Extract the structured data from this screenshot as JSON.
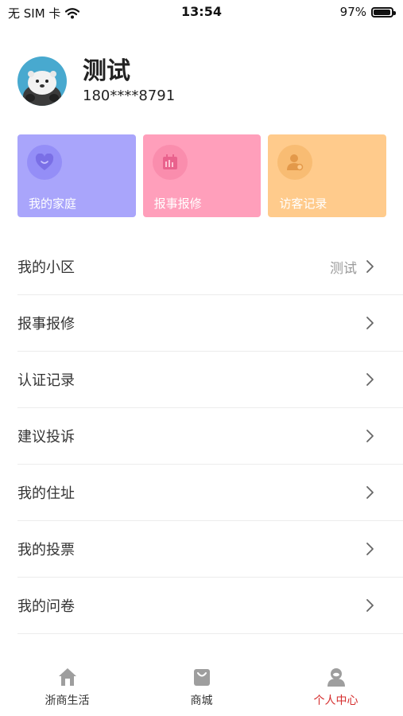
{
  "status_bar": {
    "carrier": "无 SIM 卡",
    "time": "13:54",
    "battery": "97%"
  },
  "profile": {
    "name": "测试",
    "phone": "180****8791"
  },
  "cards": [
    {
      "label": "我的家庭",
      "color": "#a9a5fb",
      "icon": "heart-icon"
    },
    {
      "label": "报事报修",
      "color": "#ff9fbb",
      "icon": "calendar-icon"
    },
    {
      "label": "访客记录",
      "color": "#ffcb8c",
      "icon": "person-icon"
    }
  ],
  "menu": [
    {
      "label": "我的小区",
      "value": "测试"
    },
    {
      "label": "报事报修",
      "value": ""
    },
    {
      "label": "认证记录",
      "value": ""
    },
    {
      "label": "建议投诉",
      "value": ""
    },
    {
      "label": "我的住址",
      "value": ""
    },
    {
      "label": "我的投票",
      "value": ""
    },
    {
      "label": "我的问卷",
      "value": ""
    }
  ],
  "tabbar": {
    "tabs": [
      {
        "label": "浙商生活",
        "icon": "home-icon",
        "active": false
      },
      {
        "label": "商城",
        "icon": "shopping-bag-icon",
        "active": false
      },
      {
        "label": "个人中心",
        "icon": "user-icon",
        "active": true
      }
    ],
    "active_color": "#d52c2c"
  }
}
